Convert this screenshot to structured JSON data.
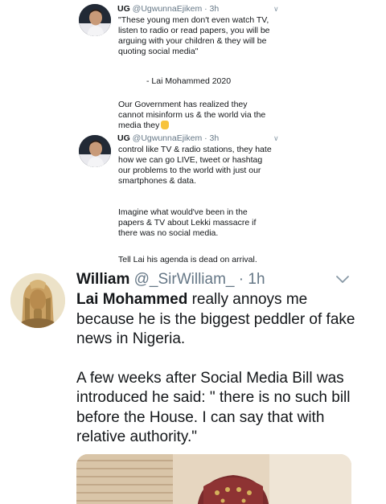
{
  "embedded": {
    "tweet1": {
      "name": "UG",
      "handle": "@UgwunnaEjikem",
      "separator": "·",
      "time": "3h",
      "lines": [
        "\"These young men don't even watch TV,",
        "listen to radio or read papers, you will be",
        "arguing with your children & they will be",
        "quoting social media\""
      ],
      "attribution": "- Lai Mohammed 2020",
      "continued": [
        "Our Government has realized they",
        "cannot misinform us & the world via the",
        "media they"
      ]
    },
    "tweet2": {
      "name": "UG",
      "handle": "@UgwunnaEjikem",
      "separator": "·",
      "time": "3h",
      "lines": [
        "control like TV & radio stations, they hate",
        "how we can go LIVE, tweet or hashtag",
        "our problems to the world with just our",
        "smartphones & data."
      ],
      "para2": [
        "Imagine what would've been in the",
        "papers & TV about Lekki massacre if",
        "there was no social media."
      ],
      "para3": "Tell Lai his agenda is dead on arrival."
    }
  },
  "tweet": {
    "name": "William",
    "handle": "@_SirWilliam_",
    "separator": "·",
    "time": "1h",
    "para1_lead": "Lai Mohammed",
    "para1_rest": " really annoys me because he is the biggest peddler of fake news in Nigeria.",
    "para2": "A few weeks after Social Media Bill was introduced he said: \"  there is no such bill before the House. I can say that with relative authority.\""
  },
  "icons": {
    "chevron": "chevron-down-icon",
    "pointing_finger": "pointing-down-emoji-icon"
  },
  "colors": {
    "text": "#14171a",
    "secondary": "#657786"
  }
}
